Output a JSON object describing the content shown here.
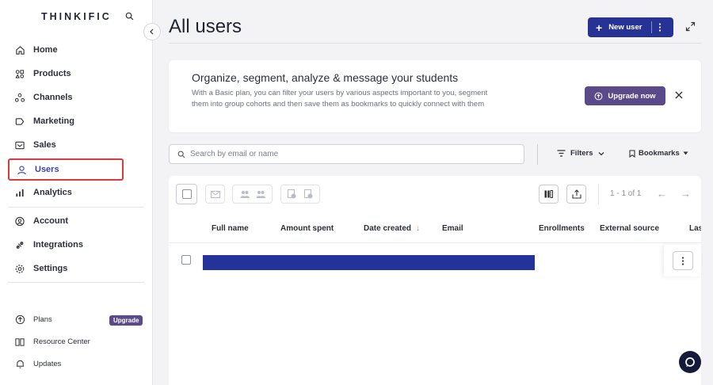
{
  "brand": {
    "logo_text": "THINKIFIC"
  },
  "sidebar": {
    "items": [
      {
        "label": "Home",
        "icon": "home-icon"
      },
      {
        "label": "Products",
        "icon": "products-icon"
      },
      {
        "label": "Channels",
        "icon": "channels-icon"
      },
      {
        "label": "Marketing",
        "icon": "marketing-icon"
      },
      {
        "label": "Sales",
        "icon": "sales-icon"
      },
      {
        "label": "Users",
        "icon": "user-icon",
        "active": true
      },
      {
        "label": "Analytics",
        "icon": "analytics-icon"
      },
      {
        "label": "Account",
        "icon": "account-icon"
      },
      {
        "label": "Integrations",
        "icon": "integrations-icon"
      },
      {
        "label": "Settings",
        "icon": "gear-icon"
      }
    ],
    "footer": [
      {
        "label": "Plans",
        "icon": "plans-icon",
        "badge": "Upgrade"
      },
      {
        "label": "Resource Center",
        "icon": "book-icon"
      },
      {
        "label": "Updates",
        "icon": "bell-icon"
      }
    ]
  },
  "header": {
    "title": "All users",
    "new_user_label": "New user"
  },
  "promo": {
    "title": "Organize, segment, analyze & message your students",
    "body": "With a Basic plan, you can filter your users by various aspects important to you, segment them into group cohorts and then save them as bookmarks to quickly connect with them",
    "upgrade_label": "Upgrade now"
  },
  "toolbar": {
    "search_placeholder": "Search by email or name",
    "filters_label": "Filters",
    "bookmarks_label": "Bookmarks"
  },
  "table": {
    "pagination": "1 - 1 of 1",
    "sort_indicator": "↓",
    "columns": [
      "Full name",
      "Amount spent",
      "Date created",
      "Email",
      "Enrollments",
      "External source",
      "Las"
    ]
  },
  "colors": {
    "primary": "#263394",
    "upgrade": "#5b4a8a",
    "active_outline": "#d93b3b",
    "sort_arrow": "#e07b39",
    "redaction": "#24339a"
  }
}
